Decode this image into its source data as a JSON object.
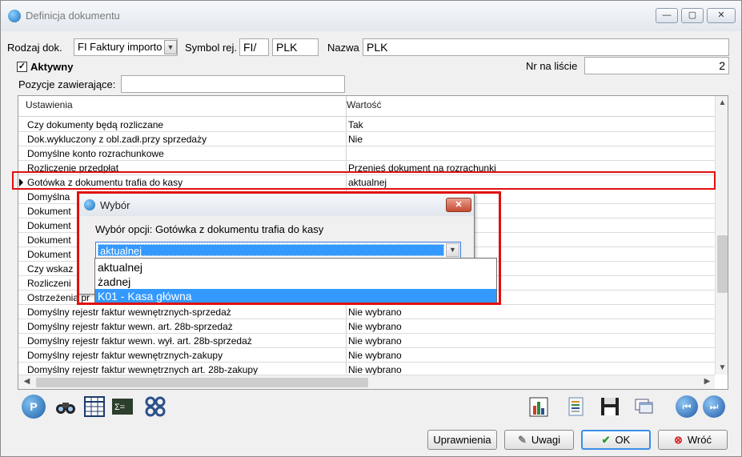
{
  "window": {
    "title": "Definicja dokumentu",
    "min_label": "—",
    "max_label": "▢",
    "close_label": "✕"
  },
  "form": {
    "rodzaj_label": "Rodzaj dok.",
    "rodzaj_value": "FI Faktury importo",
    "symbol_label": "Symbol rej.",
    "symbol_value": "FI/",
    "symbol_code": "PLK",
    "nazwa_label": "Nazwa",
    "nazwa_value": "PLK",
    "aktywny_label": "Aktywny",
    "aktywny_checked": true,
    "nr_label": "Nr na liście",
    "nr_value": "2",
    "pozycje_label": "Pozycje zawierające:",
    "pozycje_value": ""
  },
  "grid": {
    "headers": [
      "Ustawienia",
      "Wartość"
    ],
    "rows": [
      {
        "setting": "Czy dokumenty będą rozliczane",
        "value": "Tak"
      },
      {
        "setting": "Dok.wykluczony z obl.zadł.przy sprzedaży",
        "value": "Nie"
      },
      {
        "setting": "Domyślne konto rozrachunkowe",
        "value": ""
      },
      {
        "setting": "Rozliczenie przedpłat",
        "value": "Przenieś dokument na rozrachunki"
      },
      {
        "setting": "Gotówka z dokumentu trafia do kasy",
        "value": "aktualnej"
      },
      {
        "setting": "Domyślna",
        "value": ""
      },
      {
        "setting": "Dokument",
        "value": ""
      },
      {
        "setting": "Dokument",
        "value": ""
      },
      {
        "setting": "Dokument",
        "value": ""
      },
      {
        "setting": "Dokument",
        "value": ""
      },
      {
        "setting": "Czy wskaz",
        "value": ""
      },
      {
        "setting": "Rozliczeni",
        "value": ""
      },
      {
        "setting": "Ostrzeżenia pr",
        "value": ""
      },
      {
        "setting": "Domyślny rejestr faktur wewnętrznych-sprzedaż",
        "value": "Nie wybrano"
      },
      {
        "setting": "Domyślny rejestr faktur wewn. art. 28b-sprzedaż",
        "value": "Nie wybrano"
      },
      {
        "setting": "Domyślny rejestr faktur wewn. wył. art. 28b-sprzedaż",
        "value": "Nie wybrano"
      },
      {
        "setting": "Domyślny rejestr faktur wewnętrznych-zakupy",
        "value": "Nie wybrano"
      },
      {
        "setting": "Domyślny rejestr faktur wewnętrznych art. 28b-zakupy",
        "value": "Nie wybrano"
      }
    ]
  },
  "toolbar_icons": [
    "search-doc-icon",
    "binoculars-icon",
    "calculator-table-icon",
    "formula-icon",
    "gears-icon",
    "chart-icon",
    "document-list-icon",
    "save-icon",
    "windows-icon",
    "prev-icon",
    "next-icon"
  ],
  "buttons": {
    "uprawnienia": "Uprawnienia",
    "uwagi": "Uwagi",
    "ok": "OK",
    "wroc": "Wróć"
  },
  "dialog": {
    "title": "Wybór",
    "close_label": "✕",
    "prompt": "Wybór opcji:  Gotówka z dokumentu trafia do kasy",
    "selected": "aktualnej",
    "options": [
      "aktualnej",
      "żadnej",
      "K01 - Kasa główna"
    ],
    "highlighted_option": "K01 - Kasa główna"
  },
  "colors": {
    "highlight": "#3399ff",
    "annotation_red": "#e01010"
  }
}
